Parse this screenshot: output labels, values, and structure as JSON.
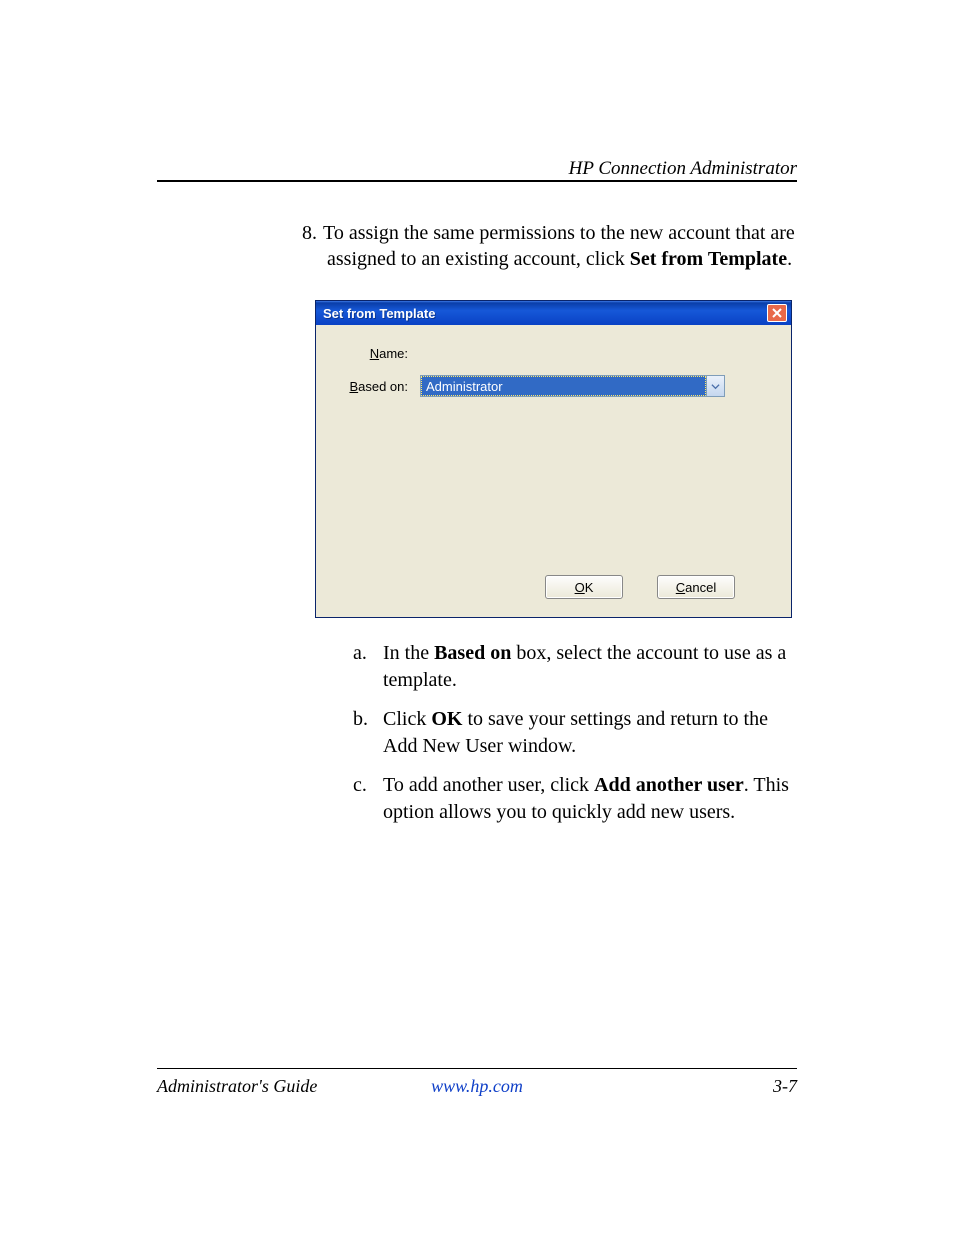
{
  "header": {
    "title": "HP Connection Administrator"
  },
  "step": {
    "number": "8.",
    "text_before_bold": "To assign the same permissions to the new account that are assigned to an existing account, click ",
    "bold": "Set from Template",
    "text_after_bold": "."
  },
  "dialog": {
    "title": "Set from Template",
    "labels": {
      "name": "Name:",
      "name_ul": "N",
      "name_rest": "ame:",
      "based_on": "Based on:",
      "based_ul": "B",
      "based_rest": "ased on:"
    },
    "combo_value": "Administrator",
    "buttons": {
      "ok": "OK",
      "ok_ul": "O",
      "ok_rest": "K",
      "cancel": "Cancel",
      "cancel_ul": "C",
      "cancel_rest": "ancel"
    }
  },
  "sub": [
    {
      "letter": "a.",
      "pre": "In the ",
      "b1": "Based on",
      "mid": " box, select the account to use as a template.",
      "b2": "",
      "post": ""
    },
    {
      "letter": "b.",
      "pre": "Click ",
      "b1": "OK",
      "mid": " to save your settings and return to the Add New User window.",
      "b2": "",
      "post": ""
    },
    {
      "letter": "c.",
      "pre": "To add another user, click ",
      "b1": "Add another user",
      "mid": ". This option allows you to quickly add new users.",
      "b2": "",
      "post": ""
    }
  ],
  "footer": {
    "left": "Administrator's Guide",
    "center": "www.hp.com",
    "right": "3-7"
  }
}
